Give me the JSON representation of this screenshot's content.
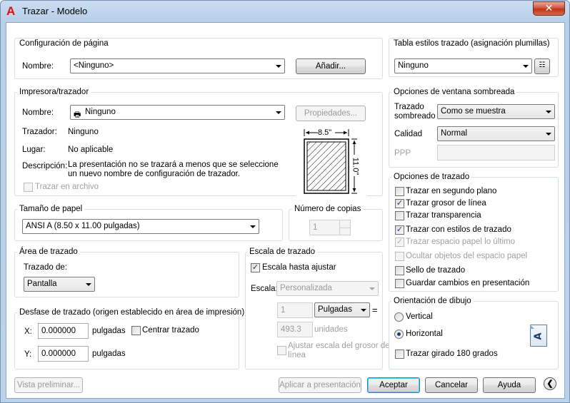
{
  "window": {
    "title": "Trazar - Modelo",
    "close_label": "✕",
    "app_icon": "A"
  },
  "page_setup": {
    "group_label": "Configuración de página",
    "name_label": "Nombre:",
    "name_value": "<Ninguno>",
    "add_button": "Añadir..."
  },
  "printer": {
    "group_label": "Impresora/trazador",
    "name_label": "Nombre:",
    "name_value": "Ninguno",
    "properties_button": "Propiedades...",
    "plotter_label": "Trazador:",
    "plotter_value": "Ninguno",
    "where_label": "Lugar:",
    "where_value": "No aplicable",
    "description_label": "Descripción:",
    "description_line1": "La presentación no se trazará a menos que se seleccione",
    "description_line2": "un nuevo nombre de configuración de trazador.",
    "plot_to_file": "Trazar en archivo",
    "preview_width": "8.5\"",
    "preview_height": "11.0\""
  },
  "paper_size": {
    "group_label": "Tamaño de papel",
    "value": "ANSI A (8.50 x 11.00 pulgadas)"
  },
  "copies": {
    "group_label": "Número de copias",
    "value": "1"
  },
  "plot_area": {
    "group_label": "Área de trazado",
    "what_label": "Trazado de:",
    "what_value": "Pantalla"
  },
  "plot_offset": {
    "group_label": "Desfase de trazado (origen establecido en área de impresión)",
    "x_label": "X:",
    "x_value": "0.000000",
    "x_unit": "pulgadas",
    "y_label": "Y:",
    "y_value": "0.000000",
    "y_unit": "pulgadas",
    "center_label": "Centrar trazado"
  },
  "plot_scale": {
    "group_label": "Escala de trazado",
    "fit_label": "Escala hasta ajustar",
    "scale_label": "Escala:",
    "scale_value": "Personalizada",
    "num_value": "1",
    "units_value": "Pulgadas",
    "equals": "=",
    "den_value": "493.3",
    "den_unit": "unidades",
    "lineweights_line1": "Ajustar escala del grosor de",
    "lineweights_line2": "línea"
  },
  "style_table": {
    "group_label": "Tabla estilos trazado (asignación plumillas)",
    "value": "Ninguno"
  },
  "shaded": {
    "group_label": "Opciones de ventana sombreada",
    "shade_label_1": "Trazado",
    "shade_label_2": "sombreado",
    "shade_value": "Como se muestra",
    "quality_label": "Calidad",
    "quality_value": "Normal",
    "dpi_label": "PPP"
  },
  "plot_options": {
    "group_label": "Opciones de trazado",
    "items": [
      {
        "label": "Trazar en segundo plano",
        "checked": false,
        "disabled": false
      },
      {
        "label": "Trazar grosor de línea",
        "checked": true,
        "disabled": false
      },
      {
        "label": "Trazar transparencia",
        "checked": false,
        "disabled": false
      },
      {
        "label": "Trazar con estilos de trazado",
        "checked": true,
        "disabled": false
      },
      {
        "label": "Trazar espacio papel lo último",
        "checked": true,
        "disabled": true
      },
      {
        "label": "Ocultar objetos del espacio papel",
        "checked": false,
        "disabled": true
      },
      {
        "label": "Sello de trazado",
        "checked": false,
        "disabled": false
      },
      {
        "label": "Guardar cambios en presentación",
        "checked": false,
        "disabled": false
      }
    ]
  },
  "orientation": {
    "group_label": "Orientación de dibujo",
    "portrait": "Vertical",
    "landscape": "Horizontal",
    "upside_down": "Trazar girado 180 grados",
    "icon_letter": "A"
  },
  "footer": {
    "preview_button": "Vista preliminar...",
    "apply_button": "Aplicar a presentación",
    "ok_button": "Aceptar",
    "cancel_button": "Cancelar",
    "help_button": "Ayuda"
  }
}
